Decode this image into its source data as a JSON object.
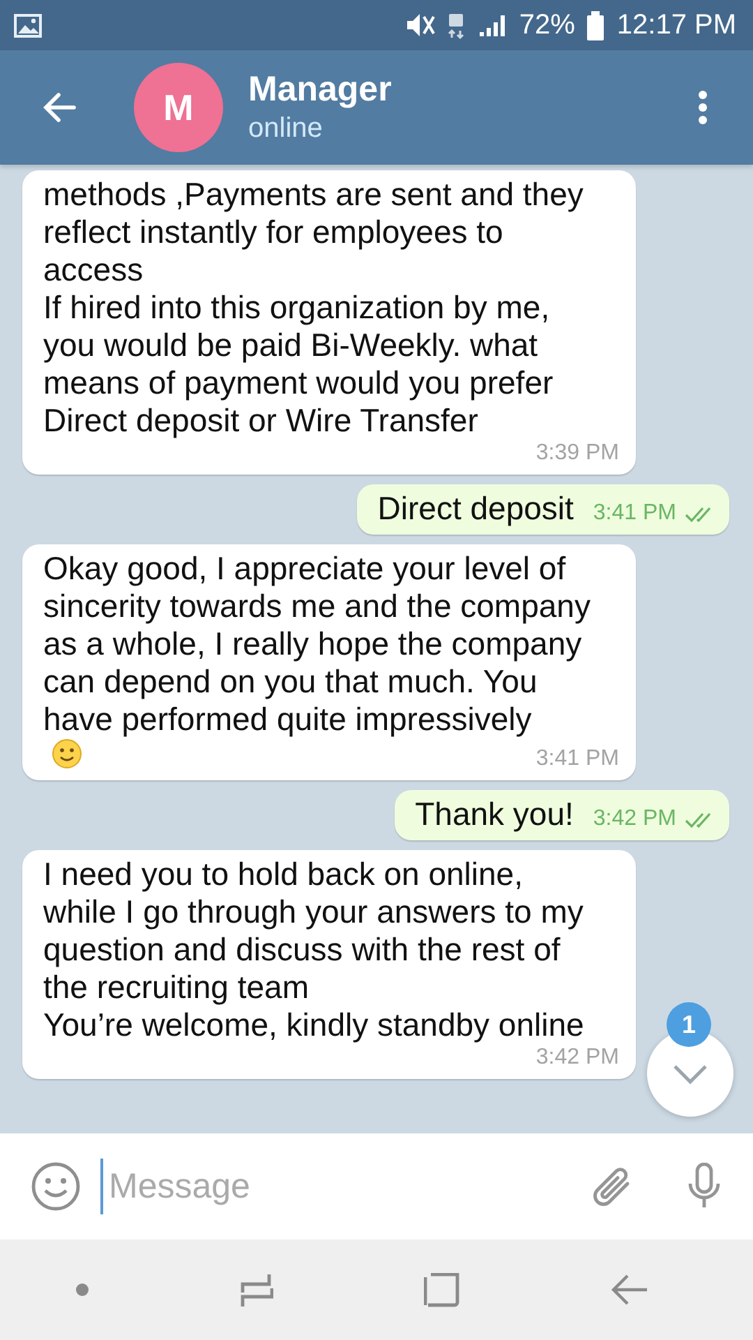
{
  "status_bar": {
    "battery": "72%",
    "time": "12:17 PM"
  },
  "header": {
    "avatar_letter": "M",
    "title": "Manager",
    "subtitle": "online"
  },
  "messages": [
    {
      "kind": "incoming",
      "text": "methods ,Payments are sent and they\nreflect instantly for employees to\naccess\nIf hired into this organization by me,\nyou would be paid Bi-Weekly. what\nmeans of payment would you prefer\nDirect deposit or Wire Transfer",
      "has_emoji": false,
      "time": "3:39 PM"
    },
    {
      "kind": "outgoing",
      "text": "Direct deposit",
      "has_emoji": false,
      "time": "3:41 PM",
      "read": true
    },
    {
      "kind": "incoming",
      "text": "Okay good, I appreciate your level of\nsincerity towards me and the company\nas a whole, I really hope the company\ncan depend on you that much. You\nhave performed quite impressively",
      "has_emoji": true,
      "time": "3:41 PM"
    },
    {
      "kind": "outgoing",
      "text": "Thank you!",
      "has_emoji": false,
      "time": "3:42 PM",
      "read": true
    },
    {
      "kind": "incoming",
      "text": "I need you to hold back on online,\nwhile I go through your answers to my\nquestion and discuss with the rest of\nthe recruiting team\nYou’re welcome, kindly standby online",
      "has_emoji": false,
      "time": "3:42 PM"
    }
  ],
  "scroll_button": {
    "badge": "1"
  },
  "composer": {
    "placeholder": "Message"
  }
}
